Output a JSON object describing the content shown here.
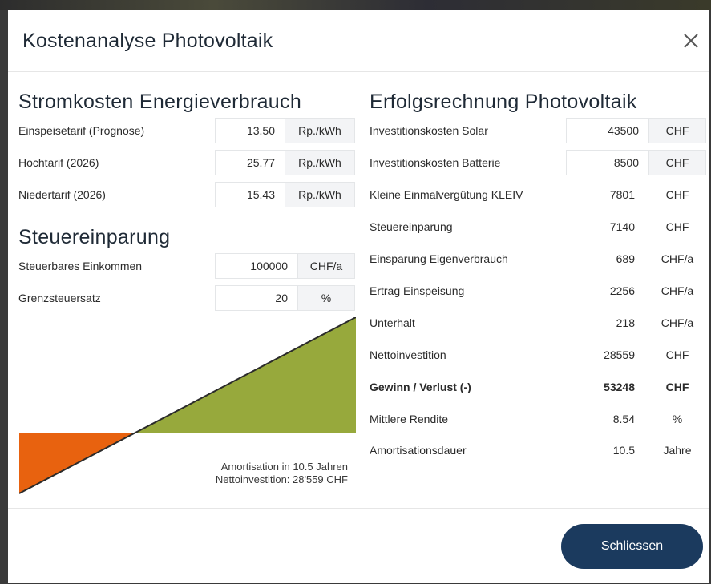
{
  "modal": {
    "title": "Kostenanalyse Photovoltaik",
    "close_label": "Schliessen"
  },
  "stromkosten": {
    "title": "Stromkosten Energieverbrauch",
    "rows": [
      {
        "label": "Einspeisetarif (Prognose)",
        "value": "13.50",
        "unit": "Rp./kWh"
      },
      {
        "label": "Hochtarif (2026)",
        "value": "25.77",
        "unit": "Rp./kWh"
      },
      {
        "label": "Niedertarif (2026)",
        "value": "15.43",
        "unit": "Rp./kWh"
      }
    ]
  },
  "steuer": {
    "title": "Steuereinparung",
    "rows": [
      {
        "label": "Steuerbares Einkommen",
        "value": "100000",
        "unit": "CHF/a"
      },
      {
        "label": "Grenzsteuersatz",
        "value": "20",
        "unit": "%"
      }
    ]
  },
  "chart": {
    "note_line1": "Amortisation in 10.5 Jahren",
    "note_line2": "Nettoinvestition: 28'559 CHF",
    "loss_color": "#e8620f",
    "gain_color": "#97a93c",
    "line_color": "#2b2b2b"
  },
  "erfolg": {
    "title": "Erfolgsrechnung Photovoltaik",
    "rows": [
      {
        "label": "Investitionskosten Solar",
        "value": "43500",
        "unit": "CHF",
        "editable": true
      },
      {
        "label": "Investitionskosten Batterie",
        "value": "8500",
        "unit": "CHF",
        "editable": true
      },
      {
        "label": "Kleine Einmalvergütung KLEIV",
        "value": "7801",
        "unit": "CHF"
      },
      {
        "label": "Steuereinparung",
        "value": "7140",
        "unit": "CHF"
      },
      {
        "label": "Einsparung Eigenverbrauch",
        "value": "689",
        "unit": "CHF/a"
      },
      {
        "label": "Ertrag Einspeisung",
        "value": "2256",
        "unit": "CHF/a"
      },
      {
        "label": "Unterhalt",
        "value": "218",
        "unit": "CHF/a"
      },
      {
        "label": "Nettoinvestition",
        "value": "28559",
        "unit": "CHF"
      },
      {
        "label": "Gewinn / Verlust (-)",
        "value": "53248",
        "unit": "CHF",
        "bold": true
      },
      {
        "label": "Mittlere Rendite",
        "value": "8.54",
        "unit": "%"
      },
      {
        "label": "Amortisationsdauer",
        "value": "10.5",
        "unit": "Jahre"
      }
    ]
  },
  "colors": {
    "button_bg": "#1b3a5e",
    "title_text": "#1f2a36"
  }
}
